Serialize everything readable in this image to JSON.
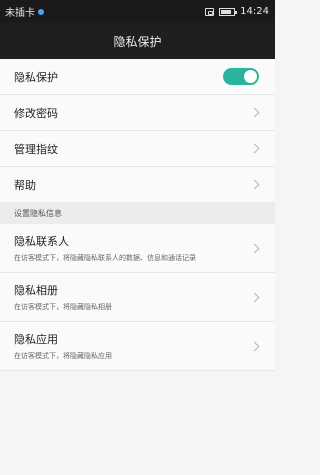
{
  "status_bar": {
    "carrier": "未插卡",
    "time": "14:24",
    "icons": [
      "sim-icon",
      "nfc-icon",
      "battery-icon"
    ],
    "battery_level": 0.85
  },
  "title_bar": {
    "title": "隐私保护"
  },
  "settings": {
    "privacy_protection": {
      "label": "隐私保护",
      "enabled": true
    },
    "change_password": {
      "label": "修改密码"
    },
    "manage_fingerprint": {
      "label": "管理指纹"
    },
    "help": {
      "label": "帮助"
    }
  },
  "section_header": "设置隐私信息",
  "privacy_items": [
    {
      "label": "隐私联系人",
      "description": "在访客模式下，将隐藏隐私联系人的数据、信息和通话记录"
    },
    {
      "label": "隐私相册",
      "description": "在访客模式下，将隐藏隐私相册"
    },
    {
      "label": "隐私应用",
      "description": "在访客模式下，将隐藏隐私应用"
    }
  ],
  "colors": {
    "toggle_on": "#2bb39b",
    "header_bg": "#1f1f1f",
    "list_bg": "#fafafa"
  }
}
